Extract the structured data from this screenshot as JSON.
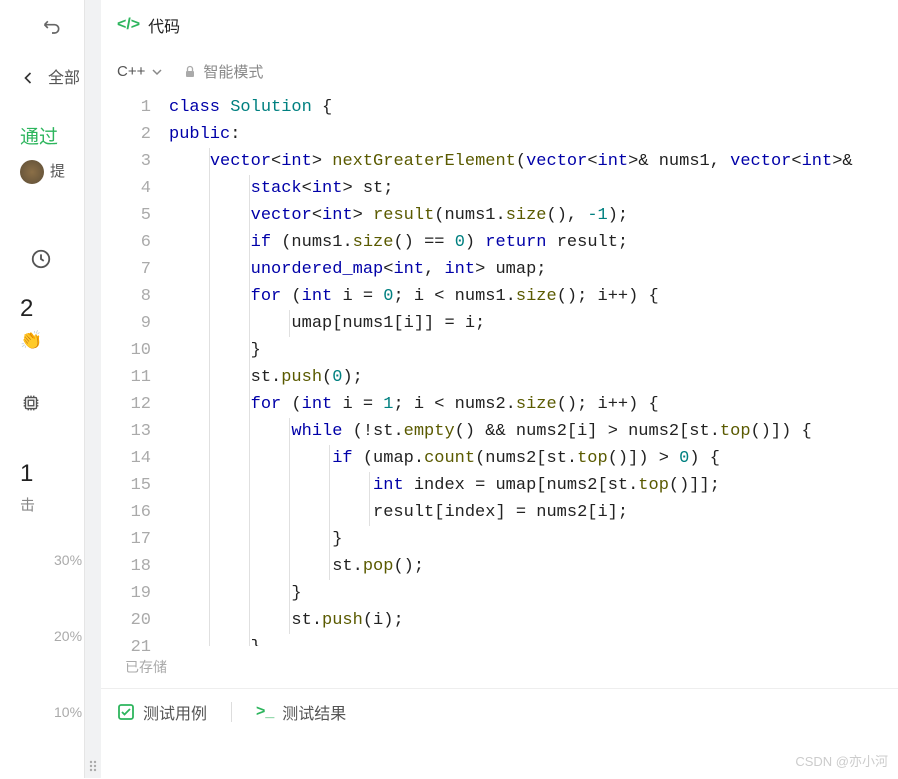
{
  "left": {
    "all": "全部",
    "pass": "通过",
    "submit": "提",
    "stat2": "2",
    "stat1": "1",
    "beat": "击",
    "pct30": "30%",
    "pct20": "20%",
    "pct10": "10%"
  },
  "header": {
    "code_label": "代码"
  },
  "toolbar": {
    "lang": "C++",
    "mode": "智能模式"
  },
  "code": {
    "lines": [
      {
        "n": 1,
        "tokens": [
          {
            "t": "class ",
            "c": "kw"
          },
          {
            "t": "Solution",
            "c": "cls"
          },
          {
            "t": " {",
            "c": ""
          }
        ]
      },
      {
        "n": 2,
        "tokens": [
          {
            "t": "public",
            "c": "kw"
          },
          {
            "t": ":",
            "c": ""
          }
        ]
      },
      {
        "n": 3,
        "tokens": [
          {
            "t": "    ",
            "c": ""
          },
          {
            "t": "vector",
            "c": "type"
          },
          {
            "t": "<",
            "c": ""
          },
          {
            "t": "int",
            "c": "kw"
          },
          {
            "t": "> ",
            "c": ""
          },
          {
            "t": "nextGreaterElement",
            "c": "fn"
          },
          {
            "t": "(",
            "c": ""
          },
          {
            "t": "vector",
            "c": "type"
          },
          {
            "t": "<",
            "c": ""
          },
          {
            "t": "int",
            "c": "kw"
          },
          {
            "t": ">& nums1, ",
            "c": ""
          },
          {
            "t": "vector",
            "c": "type"
          },
          {
            "t": "<",
            "c": ""
          },
          {
            "t": "int",
            "c": "kw"
          },
          {
            "t": ">&",
            "c": ""
          }
        ]
      },
      {
        "n": 4,
        "tokens": [
          {
            "t": "        ",
            "c": ""
          },
          {
            "t": "stack",
            "c": "type"
          },
          {
            "t": "<",
            "c": ""
          },
          {
            "t": "int",
            "c": "kw"
          },
          {
            "t": "> st;",
            "c": ""
          }
        ]
      },
      {
        "n": 5,
        "tokens": [
          {
            "t": "        ",
            "c": ""
          },
          {
            "t": "vector",
            "c": "type"
          },
          {
            "t": "<",
            "c": ""
          },
          {
            "t": "int",
            "c": "kw"
          },
          {
            "t": "> ",
            "c": ""
          },
          {
            "t": "result",
            "c": "fn"
          },
          {
            "t": "(nums1.",
            "c": ""
          },
          {
            "t": "size",
            "c": "fn"
          },
          {
            "t": "(), ",
            "c": ""
          },
          {
            "t": "-1",
            "c": "num"
          },
          {
            "t": ");",
            "c": ""
          }
        ]
      },
      {
        "n": 6,
        "tokens": [
          {
            "t": "        ",
            "c": ""
          },
          {
            "t": "if",
            "c": "kw"
          },
          {
            "t": " (nums1.",
            "c": ""
          },
          {
            "t": "size",
            "c": "fn"
          },
          {
            "t": "() == ",
            "c": ""
          },
          {
            "t": "0",
            "c": "num"
          },
          {
            "t": ") ",
            "c": ""
          },
          {
            "t": "return",
            "c": "kw"
          },
          {
            "t": " result;",
            "c": ""
          }
        ]
      },
      {
        "n": 7,
        "tokens": [
          {
            "t": "        ",
            "c": ""
          },
          {
            "t": "unordered_map",
            "c": "type"
          },
          {
            "t": "<",
            "c": ""
          },
          {
            "t": "int",
            "c": "kw"
          },
          {
            "t": ", ",
            "c": ""
          },
          {
            "t": "int",
            "c": "kw"
          },
          {
            "t": "> umap;",
            "c": ""
          }
        ]
      },
      {
        "n": 8,
        "tokens": [
          {
            "t": "        ",
            "c": ""
          },
          {
            "t": "for",
            "c": "kw"
          },
          {
            "t": " (",
            "c": ""
          },
          {
            "t": "int",
            "c": "kw"
          },
          {
            "t": " i = ",
            "c": ""
          },
          {
            "t": "0",
            "c": "num"
          },
          {
            "t": "; i < nums1.",
            "c": ""
          },
          {
            "t": "size",
            "c": "fn"
          },
          {
            "t": "(); i++) {",
            "c": ""
          }
        ]
      },
      {
        "n": 9,
        "tokens": [
          {
            "t": "            umap[nums1[i]] = i;",
            "c": ""
          }
        ]
      },
      {
        "n": 10,
        "tokens": [
          {
            "t": "        }",
            "c": ""
          }
        ]
      },
      {
        "n": 11,
        "tokens": [
          {
            "t": "        st.",
            "c": ""
          },
          {
            "t": "push",
            "c": "fn"
          },
          {
            "t": "(",
            "c": ""
          },
          {
            "t": "0",
            "c": "num"
          },
          {
            "t": ");",
            "c": ""
          }
        ]
      },
      {
        "n": 12,
        "tokens": [
          {
            "t": "        ",
            "c": ""
          },
          {
            "t": "for",
            "c": "kw"
          },
          {
            "t": " (",
            "c": ""
          },
          {
            "t": "int",
            "c": "kw"
          },
          {
            "t": " i = ",
            "c": ""
          },
          {
            "t": "1",
            "c": "num"
          },
          {
            "t": "; i < nums2.",
            "c": ""
          },
          {
            "t": "size",
            "c": "fn"
          },
          {
            "t": "(); i++) {",
            "c": ""
          }
        ]
      },
      {
        "n": 13,
        "tokens": [
          {
            "t": "            ",
            "c": ""
          },
          {
            "t": "while",
            "c": "kw"
          },
          {
            "t": " (!st.",
            "c": ""
          },
          {
            "t": "empty",
            "c": "fn"
          },
          {
            "t": "() && nums2[i] > nums2[st.",
            "c": ""
          },
          {
            "t": "top",
            "c": "fn"
          },
          {
            "t": "()]) {",
            "c": ""
          }
        ]
      },
      {
        "n": 14,
        "tokens": [
          {
            "t": "                ",
            "c": ""
          },
          {
            "t": "if",
            "c": "kw"
          },
          {
            "t": " (umap.",
            "c": ""
          },
          {
            "t": "count",
            "c": "fn"
          },
          {
            "t": "(nums2[st.",
            "c": ""
          },
          {
            "t": "top",
            "c": "fn"
          },
          {
            "t": "()]) > ",
            "c": ""
          },
          {
            "t": "0",
            "c": "num"
          },
          {
            "t": ") {",
            "c": ""
          }
        ]
      },
      {
        "n": 15,
        "tokens": [
          {
            "t": "                    ",
            "c": ""
          },
          {
            "t": "int",
            "c": "kw"
          },
          {
            "t": " index = umap[nums2[st.",
            "c": ""
          },
          {
            "t": "top",
            "c": "fn"
          },
          {
            "t": "()]];",
            "c": ""
          }
        ]
      },
      {
        "n": 16,
        "tokens": [
          {
            "t": "                    result[index] = nums2[i];",
            "c": ""
          }
        ]
      },
      {
        "n": 17,
        "tokens": [
          {
            "t": "                }",
            "c": ""
          }
        ]
      },
      {
        "n": 18,
        "tokens": [
          {
            "t": "                st.",
            "c": ""
          },
          {
            "t": "pop",
            "c": "fn"
          },
          {
            "t": "();",
            "c": ""
          }
        ]
      },
      {
        "n": 19,
        "tokens": [
          {
            "t": "            }",
            "c": ""
          }
        ]
      },
      {
        "n": 20,
        "tokens": [
          {
            "t": "            st.",
            "c": ""
          },
          {
            "t": "push",
            "c": "fn"
          },
          {
            "t": "(i);",
            "c": ""
          }
        ]
      },
      {
        "n": 21,
        "tokens": [
          {
            "t": "        }",
            "c": ""
          }
        ]
      }
    ]
  },
  "saved": "已存储",
  "tabs": {
    "testcase": "测试用例",
    "result": "测试结果"
  },
  "watermark": "CSDN @亦小河"
}
